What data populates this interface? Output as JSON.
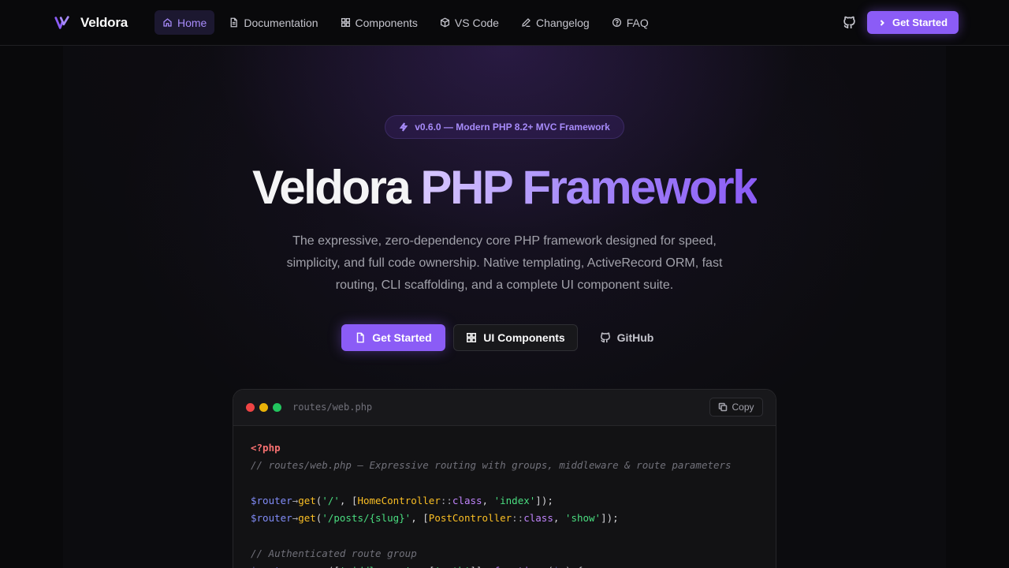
{
  "nav": {
    "brand": "Veldora",
    "links": [
      {
        "label": "Home",
        "icon": "home-icon",
        "active": true
      },
      {
        "label": "Documentation",
        "icon": "document-icon",
        "active": false
      },
      {
        "label": "Components",
        "icon": "grid-icon",
        "active": false
      },
      {
        "label": "VS Code",
        "icon": "cube-icon",
        "active": false
      },
      {
        "label": "Changelog",
        "icon": "pen-icon",
        "active": false
      },
      {
        "label": "FAQ",
        "icon": "help-circle-icon",
        "active": false
      }
    ],
    "github_icon": "github-icon",
    "cta_label": "Get Started"
  },
  "hero": {
    "badge": "v0.6.0 — Modern PHP 8.2+ MVC Framework",
    "title_plain": "Veldora ",
    "title_accent": "PHP Framework",
    "subtitle": "The expressive, zero-dependency core PHP framework designed for speed, simplicity, and full code ownership. Native templating, ActiveRecord ORM, fast routing, CLI scaffolding, and a complete UI component suite.",
    "buttons": {
      "primary": "Get Started",
      "secondary": "UI Components",
      "ghost": "GitHub"
    }
  },
  "code_window": {
    "file_name": "routes/web.php",
    "copy_label": "Copy",
    "lines": [
      [
        {
          "t": "tag",
          "v": "<?php"
        }
      ],
      [
        {
          "t": "cm",
          "v": "// routes/web.php — Expressive routing with groups, middleware & route parameters"
        }
      ],
      [],
      [
        {
          "t": "var",
          "v": "$router"
        },
        {
          "t": "op",
          "v": "→"
        },
        {
          "t": "fn",
          "v": "get"
        },
        {
          "t": "pl",
          "v": "("
        },
        {
          "t": "str",
          "v": "'/'"
        },
        {
          "t": "pl",
          "v": ", ["
        },
        {
          "t": "cls",
          "v": "HomeController"
        },
        {
          "t": "op",
          "v": "::"
        },
        {
          "t": "kw",
          "v": "class"
        },
        {
          "t": "pl",
          "v": ", "
        },
        {
          "t": "str",
          "v": "'index'"
        },
        {
          "t": "pl",
          "v": "]);"
        }
      ],
      [
        {
          "t": "var",
          "v": "$router"
        },
        {
          "t": "op",
          "v": "→"
        },
        {
          "t": "fn",
          "v": "get"
        },
        {
          "t": "pl",
          "v": "("
        },
        {
          "t": "str",
          "v": "'/posts/{slug}'"
        },
        {
          "t": "pl",
          "v": ", ["
        },
        {
          "t": "cls",
          "v": "PostController"
        },
        {
          "t": "op",
          "v": "::"
        },
        {
          "t": "kw",
          "v": "class"
        },
        {
          "t": "pl",
          "v": ", "
        },
        {
          "t": "str",
          "v": "'show'"
        },
        {
          "t": "pl",
          "v": "]);"
        }
      ],
      [],
      [
        {
          "t": "cm",
          "v": "// Authenticated route group"
        }
      ],
      [
        {
          "t": "var",
          "v": "$router"
        },
        {
          "t": "op",
          "v": "→"
        },
        {
          "t": "fn",
          "v": "group"
        },
        {
          "t": "pl",
          "v": "(["
        },
        {
          "t": "str",
          "v": "'middleware'"
        },
        {
          "t": "op",
          "v": " ⇒ "
        },
        {
          "t": "pl",
          "v": "["
        },
        {
          "t": "str",
          "v": "'auth'"
        },
        {
          "t": "pl",
          "v": "]], "
        },
        {
          "t": "kw",
          "v": "function"
        },
        {
          "t": "pl",
          "v": " ("
        },
        {
          "t": "var",
          "v": "$r"
        },
        {
          "t": "pl",
          "v": ") {"
        }
      ]
    ]
  },
  "colors": {
    "accent": "#8b5cf6",
    "accent_light": "#a78bfa",
    "background": "#09090b"
  }
}
